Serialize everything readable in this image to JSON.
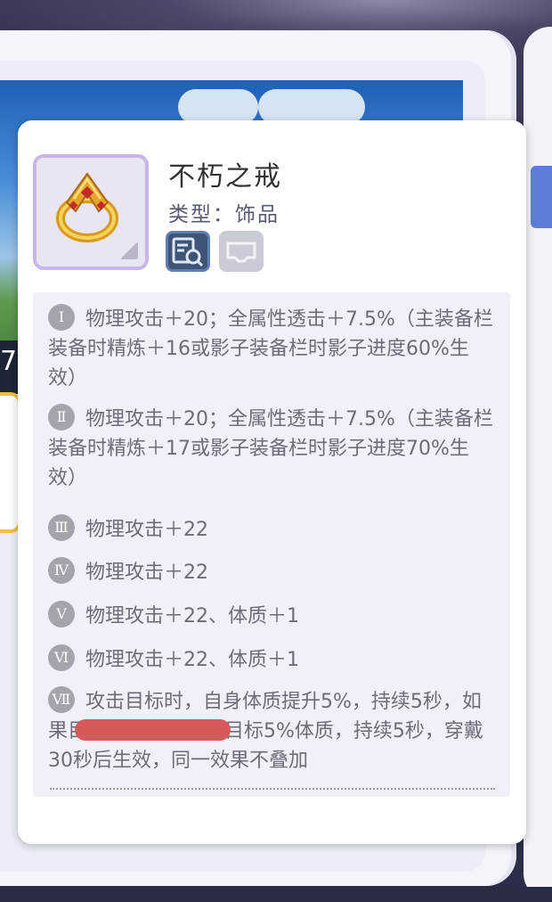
{
  "item": {
    "name": "不朽之戒",
    "type": "类型：饰品",
    "icons": {
      "inspect": "magnifier-document-icon",
      "slot": "tray-icon",
      "ring": "golden-ring-icon"
    }
  },
  "bg": {
    "bar_text": "7"
  },
  "refines": [
    {
      "roman": "Ⅰ",
      "text": "物理攻击＋20；全属性透击＋7.5%（主装备栏装备时精炼＋16或影子装备栏时影子进度60%生效）"
    },
    {
      "roman": "Ⅱ",
      "text": "物理攻击＋20；全属性透击＋7.5%（主装备栏装备时精炼＋17或影子装备栏时影子进度70%生效）"
    },
    {
      "roman": "Ⅲ",
      "text": "物理攻击＋22"
    },
    {
      "roman": "Ⅳ",
      "text": "物理攻击＋22"
    },
    {
      "roman": "Ⅴ",
      "text": "物理攻击＋22、体质＋1"
    },
    {
      "roman": "Ⅵ",
      "text": "物理攻击＋22、体质＋1"
    },
    {
      "roman": "Ⅶ",
      "text": "攻击目标时，自身体质提升5%，持续5秒，如果目标是玩家，降低目标5%体质，持续5秒，穿戴30秒后生效，同一效果不叠加"
    }
  ],
  "colors": {
    "card_bg": "#ffffff",
    "desc_bg": "#f0f1f8",
    "text": "#6b6d78",
    "frame_border": "#c9b6e8",
    "redaction": "#d65a5c"
  }
}
